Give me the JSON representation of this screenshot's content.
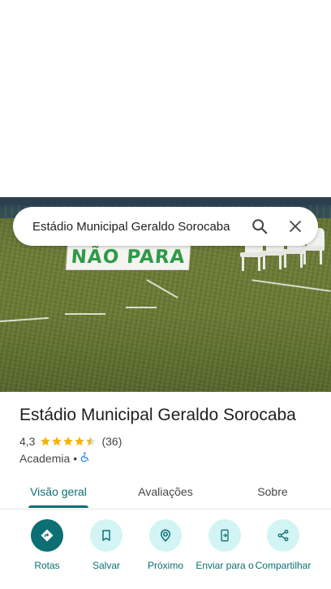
{
  "search": {
    "query": "Estádio Municipal Geraldo Sorocaba",
    "search_icon": "search-icon",
    "close_icon": "close-icon"
  },
  "photo": {
    "sign_text": "NÃO PARA"
  },
  "place": {
    "name": "Estádio Municipal Geraldo Sorocaba",
    "rating": "4,3",
    "stars_value": 4.3,
    "reviews_count": "(36)",
    "category": "Academia",
    "separator": "•",
    "accessibility_icon": "wheelchair-icon"
  },
  "tabs": [
    {
      "label": "Visão geral",
      "active": true
    },
    {
      "label": "Avaliações",
      "active": false
    },
    {
      "label": "Sobre",
      "active": false
    }
  ],
  "actions": [
    {
      "label": "Rotas",
      "icon": "directions-icon"
    },
    {
      "label": "Salvar",
      "icon": "bookmark-icon"
    },
    {
      "label": "Próximo",
      "icon": "nearby-icon"
    },
    {
      "label": "Enviar para o",
      "icon": "send-to-phone-icon"
    },
    {
      "label": "Compartilhar",
      "icon": "share-icon"
    }
  ],
  "colors": {
    "accent": "#0b6f73",
    "accent_light": "#d3f4f4",
    "star": "#f4b400",
    "text_secondary": "#444746"
  }
}
